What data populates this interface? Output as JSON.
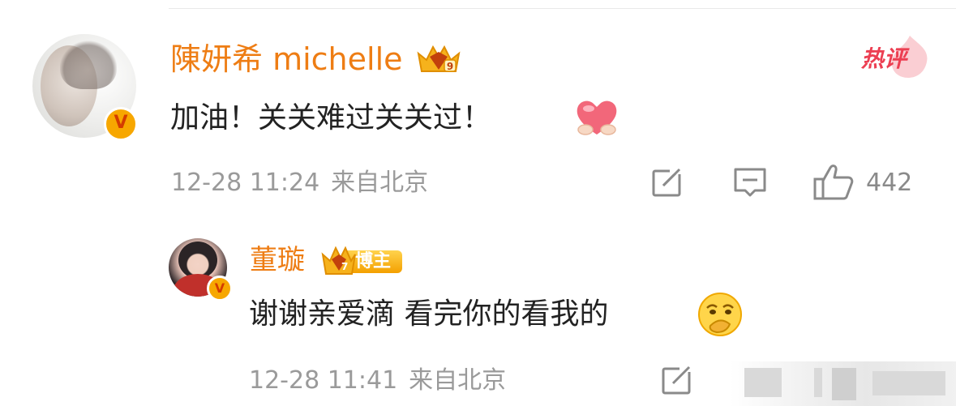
{
  "comment": {
    "author": "陳妍希 michelle",
    "text": "加油！关关难过关关过！",
    "date": "12-28 11:24",
    "location": "来自北京",
    "likes": "442",
    "hot_label": "热评",
    "verified_badge": "V",
    "level_badge": "9"
  },
  "reply": {
    "author": "董璇",
    "author_badge": "博主",
    "level_badge": "7",
    "text": "谢谢亲爱滴 看完你的看我的",
    "date": "12-28 11:41",
    "location": "来自北京",
    "verified_badge": "V"
  },
  "icons": {
    "share": "share-icon",
    "comment": "comment-icon",
    "like": "thumbs-up-icon",
    "heart_emoji": "heart-emoji-icon",
    "face_emoji": "thinking-face-emoji-icon",
    "crown": "crown-icon"
  },
  "colors": {
    "author_name": "#ee7d14",
    "hot_label": "#ec3f52",
    "meta_text": "#9a9a9a",
    "body_text": "#222222",
    "verified_badge": "#f7a700"
  }
}
